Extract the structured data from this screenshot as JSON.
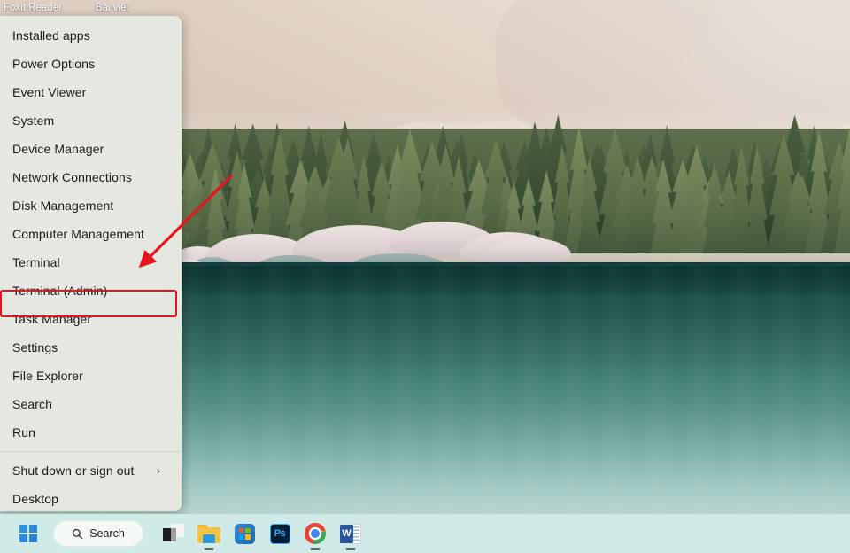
{
  "topbar": {
    "items": [
      {
        "label": "Foxit Reader"
      },
      {
        "label": "Bài viết"
      }
    ]
  },
  "winx_menu": {
    "name": "Windows quick link menu",
    "background_color": "#e5e8e0",
    "highlight": {
      "target": "Terminal (Admin)",
      "border_color": "#e8141c"
    },
    "items": [
      {
        "label": "Installed apps",
        "type": "item",
        "submenu": false
      },
      {
        "label": "Power Options",
        "type": "item",
        "submenu": false
      },
      {
        "label": "Event Viewer",
        "type": "item",
        "submenu": false
      },
      {
        "label": "System",
        "type": "item",
        "submenu": false
      },
      {
        "label": "Device Manager",
        "type": "item",
        "submenu": false
      },
      {
        "label": "Network Connections",
        "type": "item",
        "submenu": false
      },
      {
        "label": "Disk Management",
        "type": "item",
        "submenu": false
      },
      {
        "label": "Computer Management",
        "type": "item",
        "submenu": false
      },
      {
        "label": "Terminal",
        "type": "item",
        "submenu": false
      },
      {
        "label": "Terminal (Admin)",
        "type": "item",
        "submenu": false,
        "highlighted": true
      },
      {
        "label": "Task Manager",
        "type": "item",
        "submenu": false
      },
      {
        "label": "Settings",
        "type": "item",
        "submenu": false
      },
      {
        "label": "File Explorer",
        "type": "item",
        "submenu": false
      },
      {
        "label": "Search",
        "type": "item",
        "submenu": false
      },
      {
        "label": "Run",
        "type": "item",
        "submenu": false
      },
      {
        "label": "",
        "type": "separator",
        "submenu": false
      },
      {
        "label": "Shut down or sign out",
        "type": "item",
        "submenu": true,
        "chevron": "›"
      },
      {
        "label": "Desktop",
        "type": "item",
        "submenu": false
      }
    ]
  },
  "annotation": {
    "arrow_color": "#e8141c",
    "points_to": "Terminal (Admin)"
  },
  "taskbar": {
    "background_color": "#cfeae7",
    "start_button": {
      "name": "start-button",
      "icon": "windows-logo-icon"
    },
    "search": {
      "placeholder": "Search",
      "icon": "search-icon",
      "value": ""
    },
    "apps": [
      {
        "name": "task-view",
        "icon": "task-view-icon",
        "running": false
      },
      {
        "name": "file-explorer",
        "icon": "folder-icon",
        "running": true
      },
      {
        "name": "microsoft-store",
        "icon": "store-icon",
        "running": false
      },
      {
        "name": "photoshop",
        "icon": "photoshop-icon",
        "label": "Ps",
        "running": false
      },
      {
        "name": "google-chrome",
        "icon": "chrome-icon",
        "running": true
      },
      {
        "name": "microsoft-word",
        "icon": "word-icon",
        "label": "W",
        "running": true
      }
    ]
  },
  "wallpaper": {
    "description": "Mountain, pine forest and turquoise alpine lake",
    "sky_color": "#e7dbd0",
    "forest_color": "#4e6141",
    "water_color": "#3a756c"
  }
}
